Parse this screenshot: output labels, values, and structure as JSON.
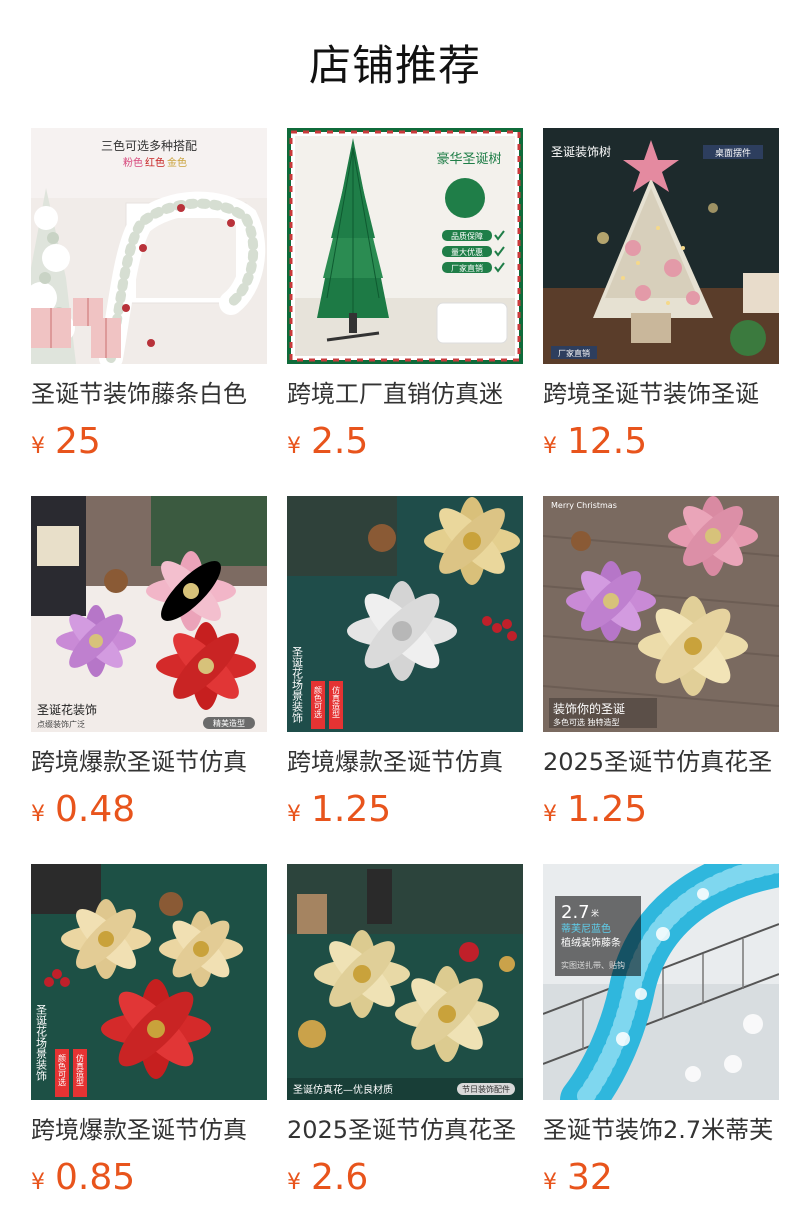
{
  "header": {
    "title": "店铺推荐"
  },
  "products": [
    {
      "name": "圣诞节装饰藤条白色",
      "currency": "¥",
      "price": "25",
      "image_icon": "flocked-garland-image",
      "overlay": {
        "t1": "三色可选多种搭配",
        "t2": "粉色",
        "t3": "红色",
        "t4": "金色"
      }
    },
    {
      "name": "跨境工厂直销仿真迷",
      "currency": "¥",
      "price": "2.5",
      "image_icon": "green-christmas-tree-image",
      "overlay": {
        "t1": "豪华圣诞树",
        "t2": "品质保障",
        "t3": "量大优惠",
        "t4": "厂家直销"
      }
    },
    {
      "name": "跨境圣诞节装饰圣诞",
      "currency": "¥",
      "price": "12.5",
      "image_icon": "tabletop-tree-image",
      "overlay": {
        "t1": "圣诞装饰树",
        "t2": "桌面摆件",
        "t3": "厂家直销"
      }
    },
    {
      "name": "跨境爆款圣诞节仿真",
      "currency": "¥",
      "price": "0.48",
      "image_icon": "poinsettia-flowers-image",
      "overlay": {
        "t1": "圣诞花装饰",
        "t2": "点缀装饰广泛",
        "t3": "精美造型"
      }
    },
    {
      "name": "跨境爆款圣诞节仿真",
      "currency": "¥",
      "price": "1.25",
      "image_icon": "silver-gold-flowers-image",
      "overlay": {
        "t1": "圣诞花场景装饰",
        "t2": "颜色可选",
        "t3": "仿真造型"
      }
    },
    {
      "name": "2025圣诞节仿真花圣",
      "currency": "¥",
      "price": "1.25",
      "image_icon": "pink-gold-flowers-image",
      "overlay": {
        "t1": "Merry Christmas",
        "t2": "装饰你的圣诞",
        "t3": "多色可选 独特造型"
      }
    },
    {
      "name": "跨境爆款圣诞节仿真",
      "currency": "¥",
      "price": "0.85",
      "image_icon": "gold-red-flowers-image",
      "overlay": {
        "t1": "圣诞花场景装饰",
        "t2": "颜色可选",
        "t3": "仿真造型"
      }
    },
    {
      "name": "2025圣诞节仿真花圣",
      "currency": "¥",
      "price": "2.6",
      "image_icon": "gold-flowers-ornaments-image",
      "overlay": {
        "t1": "圣诞仿真花—优良材质",
        "t2": "节日装饰配件"
      }
    },
    {
      "name": "圣诞节装饰2.7米蒂芙",
      "currency": "¥",
      "price": "32",
      "image_icon": "blue-garland-image",
      "overlay": {
        "t1": "2.7",
        "t2": "米",
        "t3": "蒂芙尼蓝色",
        "t4": "植绒装饰藤条",
        "t5": "实图送扎带、贴钩"
      }
    }
  ]
}
